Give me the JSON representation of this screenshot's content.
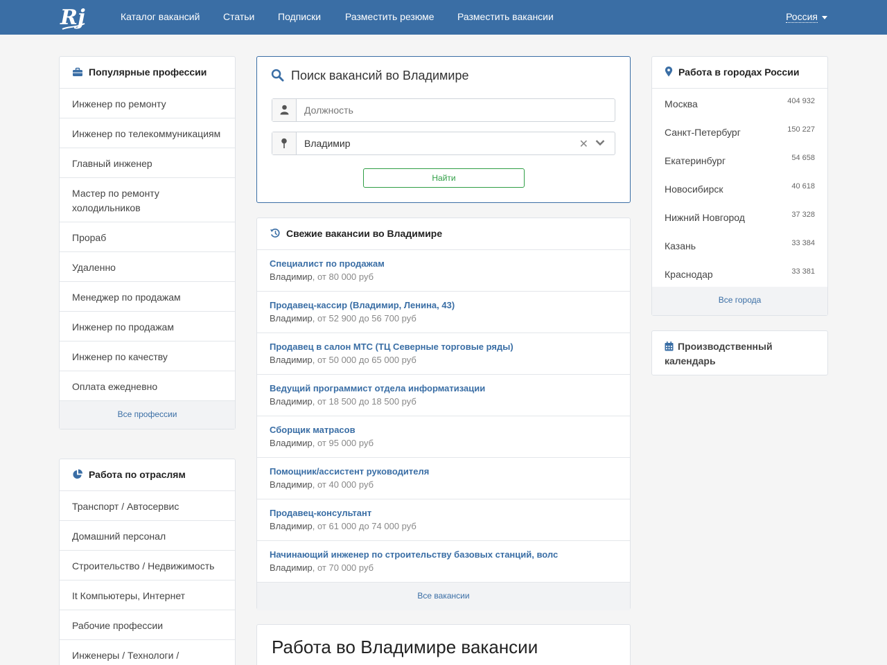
{
  "brand": {
    "logo_text": "Rj"
  },
  "nav": {
    "items": [
      {
        "label": "Каталог вакансий"
      },
      {
        "label": "Статьи"
      },
      {
        "label": "Подписки"
      },
      {
        "label": "Разместить резюме"
      },
      {
        "label": "Разместить вакансии"
      }
    ],
    "region": "Россия"
  },
  "popular": {
    "title": "Популярные профессии",
    "items": [
      "Инженер по ремонту",
      "Инженер по телекоммуникациям",
      "Главный инженер",
      "Мастер по ремонту холодильников",
      "Прораб",
      "Удаленно",
      "Менеджер по продажам",
      "Инженер по продажам",
      "Инженер по качеству",
      "Оплата ежедневно"
    ],
    "footer": "Все профессии"
  },
  "industries": {
    "title": "Работа по отраслям",
    "items": [
      "Транспорт / Автосервис",
      "Домашний персонал",
      "Строительство / Недвижимость",
      "It Компьютеры, Интернет",
      "Рабочие профессии",
      "Инженеры / Технологи /"
    ]
  },
  "search": {
    "title": "Поиск вакансий во Владимире",
    "position_placeholder": "Должность",
    "city_value": "Владимир",
    "button": "Найти"
  },
  "fresh": {
    "title": "Свежие вакансии во Владимире",
    "items": [
      {
        "title": "Специалист по продажам",
        "city": "Владимир",
        "salary": ", от 80 000 руб"
      },
      {
        "title": "Продавец-кассир (Владимир, Ленина, 43)",
        "city": "Владимир",
        "salary": ", от 52 900 до 56 700 руб"
      },
      {
        "title": "Продавец в салон МТС (ТЦ Северные торговые ряды)",
        "city": "Владимир",
        "salary": ", от 50 000 до 65 000 руб"
      },
      {
        "title": "Ведущий программист отдела информатизации",
        "city": "Владимир",
        "salary": ", от 18 500 до 18 500 руб"
      },
      {
        "title": "Сборщик матрасов",
        "city": "Владимир",
        "salary": ", от 95 000 руб"
      },
      {
        "title": "Помощник/ассистент руководителя",
        "city": "Владимир",
        "salary": ", от 40 000 руб"
      },
      {
        "title": "Продавец-консультант",
        "city": "Владимир",
        "salary": ", от 61 000 до 74 000 руб"
      },
      {
        "title": "Начинающий инженер по строительству базовых станций, волс",
        "city": "Владимир",
        "salary": ", от 70 000 руб"
      }
    ],
    "footer": "Все вакансии"
  },
  "work_heading": "Работа во Владимире вакансии",
  "cities": {
    "title": "Работа в городах России",
    "items": [
      {
        "name": "Москва",
        "count": "404 932"
      },
      {
        "name": "Санкт-Петербург",
        "count": "150 227"
      },
      {
        "name": "Екатеринбург",
        "count": "54 658"
      },
      {
        "name": "Новосибирск",
        "count": "40 618"
      },
      {
        "name": "Нижний Новгород",
        "count": "37 328"
      },
      {
        "name": "Казань",
        "count": "33 384"
      },
      {
        "name": "Краснодар",
        "count": "33 381"
      }
    ],
    "footer": "Все города"
  },
  "calendar": {
    "title": "Производственный календарь"
  },
  "colors": {
    "primary": "#3a6ea5",
    "success": "#2e9e44",
    "page_bg": "#f5f5f5"
  },
  "icons": [
    "briefcase-icon",
    "pie-chart-icon",
    "search-icon",
    "user-icon",
    "map-pin-icon",
    "history-icon",
    "location-icon",
    "calendar-icon",
    "chevron-down-icon",
    "clear-icon"
  ]
}
